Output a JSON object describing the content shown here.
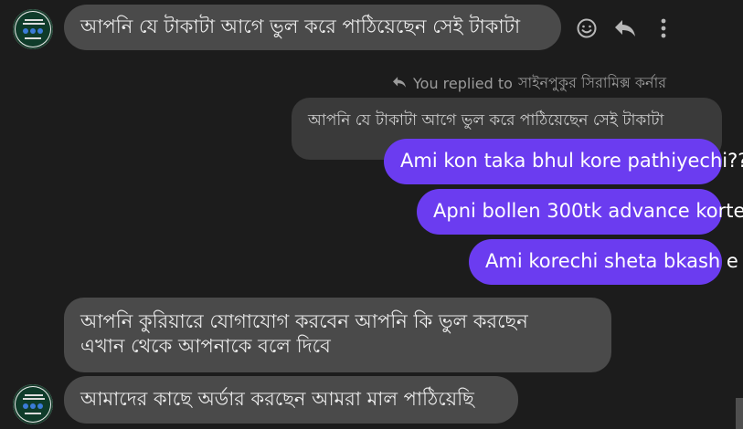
{
  "messages": {
    "m1": "আপনি যে টাকাটা আগে ভুল করে পাঠিয়েছেন সেই টাকাটা",
    "reply_note_prefix": "You replied to",
    "reply_note_name": "সাইনপুকুর সিরামিক্স কর্নার",
    "quoted": "আপনি যে টাকাটা আগে ভুল করে পাঠিয়েছেন সেই টাকাটা",
    "out1": "Ami kon taka bhul kore pathiyechi??",
    "out2": "Apni bollen 300tk advance korte",
    "out3": "Ami korechi sheta bkash e",
    "m2_line1": "আপনি কুরিয়ারে যোগাযোগ করবেন আপনি কি ভুল করছেন",
    "m2_line2": "এখান থেকে আপনাকে বলে দিবে",
    "m3": "আমাদের কাছে অর্ডার করছেন আমরা মাল পাঠিয়েছি"
  },
  "icons": {
    "emoji": "smiley-icon",
    "reply": "reply-icon",
    "more": "more-vertical-icon",
    "replied_arrow": "reply-arrow-icon"
  },
  "colors": {
    "background": "#1c1c1c",
    "incoming_bubble": "#4a4a4a",
    "outgoing_bubble": "#6b3cf0",
    "quoted_bubble": "#3a3a3a"
  }
}
